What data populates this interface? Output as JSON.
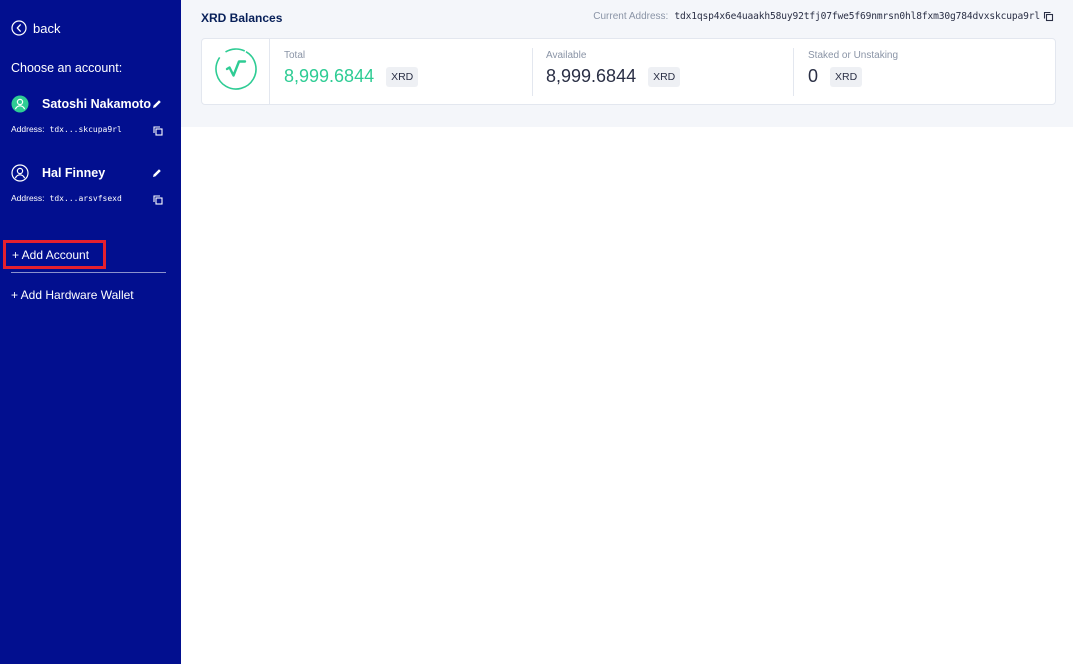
{
  "sidebar": {
    "back_label": "back",
    "choose_label": "Choose an account:",
    "accounts": [
      {
        "name": "Satoshi Nakamoto",
        "address_label": "Address:",
        "address": "tdx...skcupa9rl",
        "active": true
      },
      {
        "name": "Hal Finney",
        "address_label": "Address:",
        "address": "tdx...arsvfsexd",
        "active": false
      }
    ],
    "add_account_label": "+ Add Account",
    "add_hardware_wallet_label": "+ Add Hardware Wallet"
  },
  "main": {
    "title": "XRD Balances",
    "current_address_label": "Current Address:",
    "current_address": "tdx1qsp4x6e4uaakh58uy92tfj07fwe5f69nmrsn0hl8fxm30g784dvxskcupa9rl",
    "balances": {
      "total": {
        "label": "Total",
        "value": "8,999.6844",
        "token": "XRD"
      },
      "available": {
        "label": "Available",
        "value": "8,999.6844",
        "token": "XRD"
      },
      "staked": {
        "label": "Staked or Unstaking",
        "value": "0",
        "token": "XRD"
      }
    }
  },
  "colors": {
    "sidebar_bg": "#020f8f",
    "accent_green": "#2ecc94",
    "highlight_red": "#e6202e",
    "header_bg": "#f4f6fa",
    "title_text": "#082059"
  },
  "icons": {
    "back": "chevron-left-circle-icon",
    "active_avatar": "user-circle-icon",
    "inactive_avatar": "user-circle-outline-icon",
    "edit": "pencil-icon",
    "copy": "copy-icon",
    "logo": "radix-logo-icon"
  }
}
